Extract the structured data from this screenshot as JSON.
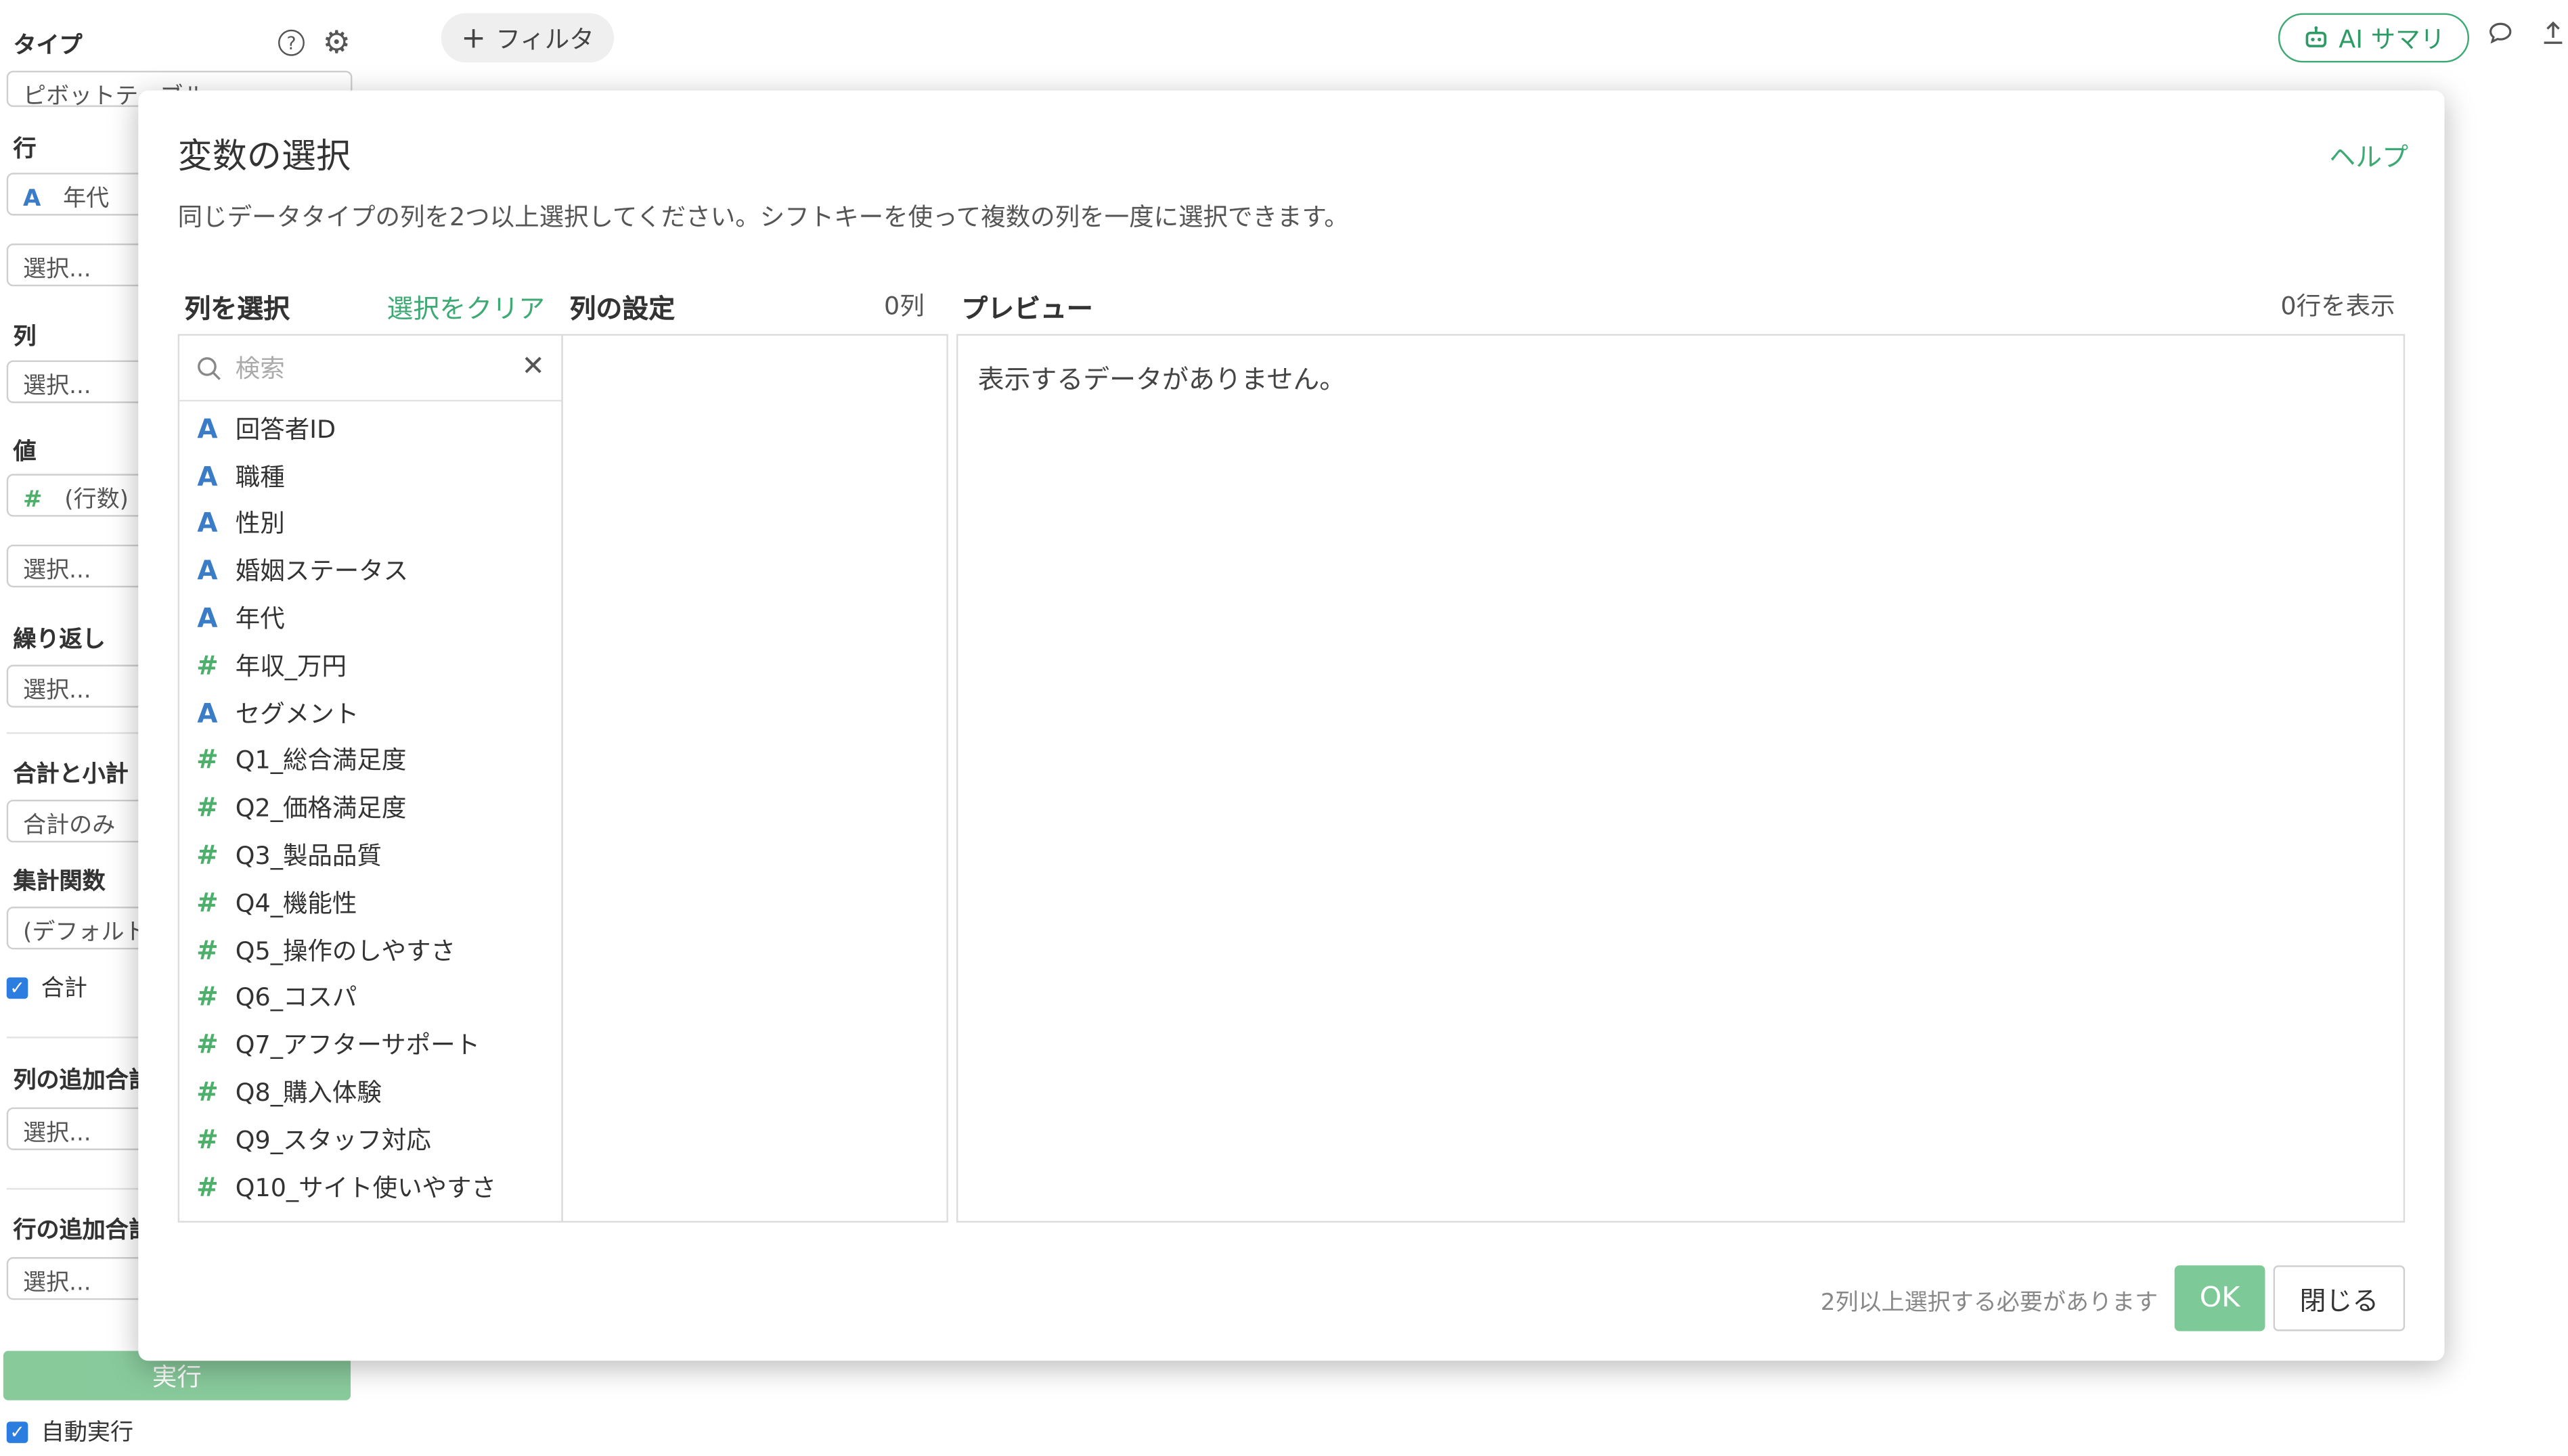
{
  "sidebar": {
    "type_label": "タイプ",
    "type_value": "ピボットテーブル",
    "row_label": "行",
    "row_item": {
      "type_glyph": "A",
      "text": "年代"
    },
    "row_select": "選択...",
    "col_label": "列",
    "col_select": "選択...",
    "val_label": "値",
    "val_item": {
      "type_glyph": "#",
      "text": "(行数)"
    },
    "val_select": "選択...",
    "repeat_label": "繰り返し",
    "repeat_select": "選択...",
    "totals_label": "合計と小計",
    "totals_value": "合計のみ",
    "agg_label": "集計関数",
    "agg_value": "(デフォルト",
    "total_check": "合計",
    "col_extra_label": "列の追加合計",
    "col_extra_select": "選択...",
    "row_extra_label": "行の追加合計",
    "row_extra_select": "選択...",
    "run_button": "実行",
    "auto_run": "自動実行"
  },
  "topbar": {
    "filter_button": "フィルタ",
    "ai_button": "AI サマリ"
  },
  "modal": {
    "title": "変数の選択",
    "help": "ヘルプ",
    "description": "同じデータタイプの列を2つ以上選択してください。シフトキーを使って複数の列を一度に選択できます。",
    "select_columns": "列を選択",
    "clear_selection": "選択をクリア",
    "column_settings": "列の設定",
    "column_count": "0列",
    "preview": "プレビュー",
    "rows_shown": "0行を表示",
    "search_placeholder": "検索",
    "no_data": "表示するデータがありません。",
    "footer_message": "2列以上選択する必要があります",
    "ok_button": "OK",
    "close_button": "閉じる",
    "variables": [
      {
        "type": "text",
        "glyph": "A",
        "name": "回答者ID"
      },
      {
        "type": "text",
        "glyph": "A",
        "name": "職種"
      },
      {
        "type": "text",
        "glyph": "A",
        "name": "性別"
      },
      {
        "type": "text",
        "glyph": "A",
        "name": "婚姻ステータス"
      },
      {
        "type": "text",
        "glyph": "A",
        "name": "年代"
      },
      {
        "type": "number",
        "glyph": "#",
        "name": "年収_万円"
      },
      {
        "type": "text",
        "glyph": "A",
        "name": "セグメント"
      },
      {
        "type": "number",
        "glyph": "#",
        "name": "Q1_総合満足度"
      },
      {
        "type": "number",
        "glyph": "#",
        "name": "Q2_価格満足度"
      },
      {
        "type": "number",
        "glyph": "#",
        "name": "Q3_製品品質"
      },
      {
        "type": "number",
        "glyph": "#",
        "name": "Q4_機能性"
      },
      {
        "type": "number",
        "glyph": "#",
        "name": "Q5_操作のしやすさ"
      },
      {
        "type": "number",
        "glyph": "#",
        "name": "Q6_コスパ"
      },
      {
        "type": "number",
        "glyph": "#",
        "name": "Q7_アフターサポート"
      },
      {
        "type": "number",
        "glyph": "#",
        "name": "Q8_購入体験"
      },
      {
        "type": "number",
        "glyph": "#",
        "name": "Q9_スタッフ対応"
      },
      {
        "type": "number",
        "glyph": "#",
        "name": "Q10_サイト使いやすさ"
      }
    ]
  },
  "colors": {
    "accent_green": "#3daa74",
    "text_type": "#3a7cc6",
    "number_type": "#4caf6a"
  }
}
